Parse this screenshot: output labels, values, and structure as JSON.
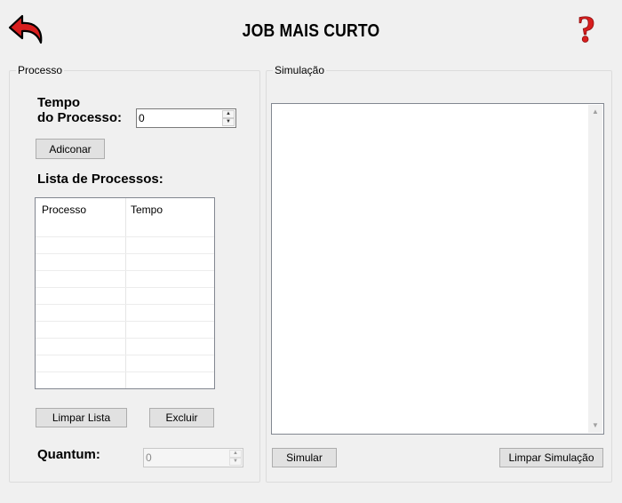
{
  "header": {
    "title": "JOB MAIS CURTO",
    "back_icon": "back-arrow-icon",
    "help_icon": "question-mark-icon",
    "help_glyph": "?",
    "accent_color": "#d81e1e"
  },
  "processo": {
    "group_label": "Processo",
    "tempo_label_line1": "Tempo",
    "tempo_label_line2": "do Processo:",
    "tempo_value": "0",
    "add_button": "Adiconar",
    "list_label": "Lista de Processos:",
    "table": {
      "columns": [
        "Processo",
        "Tempo"
      ],
      "rows": []
    },
    "clear_list_button": "Limpar Lista",
    "delete_button": "Excluir",
    "quantum_label": "Quantum:",
    "quantum_value": "0"
  },
  "simulacao": {
    "group_label": "Simulação",
    "output_text": "",
    "simulate_button": "Simular",
    "clear_simulation_button": "Limpar Simulação"
  }
}
